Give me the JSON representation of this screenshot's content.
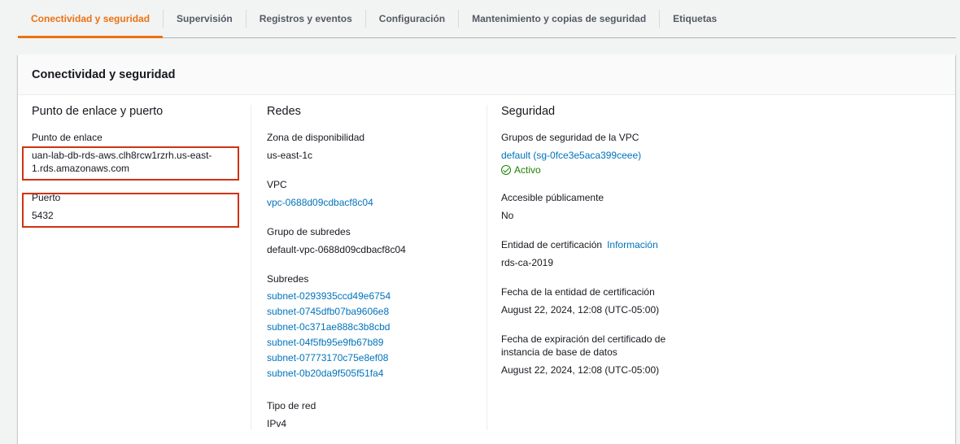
{
  "tabs": [
    {
      "label": "Conectividad y seguridad",
      "active": true
    },
    {
      "label": "Supervisión"
    },
    {
      "label": "Registros y eventos"
    },
    {
      "label": "Configuración"
    },
    {
      "label": "Mantenimiento y copias de seguridad"
    },
    {
      "label": "Etiquetas"
    }
  ],
  "panel": {
    "title": "Conectividad y seguridad"
  },
  "endpoint": {
    "title": "Punto de enlace y puerto",
    "endpoint_label": "Punto de enlace",
    "endpoint_value_line1": "uan-lab-db-rds-aws.clh8rcw1rzrh.us-east-",
    "endpoint_value_line2": "1.rds.amazonaws.com",
    "port_label": "Puerto",
    "port_value": "5432"
  },
  "networking": {
    "title": "Redes",
    "az_label": "Zona de disponibilidad",
    "az_value": "us-east-1c",
    "vpc_label": "VPC",
    "vpc_value": "vpc-0688d09cdbacf8c04",
    "subnet_group_label": "Grupo de subredes",
    "subnet_group_value": "default-vpc-0688d09cdbacf8c04",
    "subnets_label": "Subredes",
    "subnets": [
      "subnet-0293935ccd49e6754",
      "subnet-0745dfb07ba9606e8",
      "subnet-0c371ae888c3b8cbd",
      "subnet-04f5fb95e9fb67b89",
      "subnet-07773170c75e8ef08",
      "subnet-0b20da9f505f51fa4"
    ],
    "network_type_label": "Tipo de red",
    "network_type_value": "IPv4"
  },
  "security": {
    "title": "Seguridad",
    "sg_label": "Grupos de seguridad de la VPC",
    "sg_value": "default (sg-0fce3e5aca399ceee)",
    "sg_status": "Activo",
    "public_label": "Accesible públicamente",
    "public_value": "No",
    "ca_label": "Entidad de certificación",
    "ca_info": "Información",
    "ca_value": "rds-ca-2019",
    "ca_date_label": "Fecha de la entidad de certificación",
    "ca_date_value": "August 22, 2024, 12:08 (UTC-05:00)",
    "cert_exp_label_line1": "Fecha de expiración del certificado de",
    "cert_exp_label_line2": "instancia de base de datos",
    "cert_exp_value": "August 22, 2024, 12:08 (UTC-05:00)"
  },
  "colors": {
    "accent": "#ec7211",
    "link": "#0073bb",
    "success": "#1d8102",
    "highlight": "#d13212"
  }
}
